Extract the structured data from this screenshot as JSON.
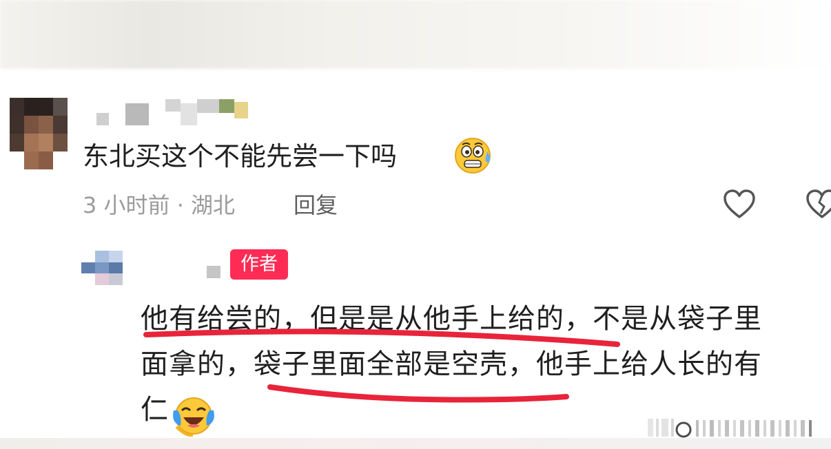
{
  "comment": {
    "text": "东北买这个不能先尝一下吗",
    "emoji_icon": "sweating-face-icon",
    "meta": "3 小时前 · 湖北",
    "reply_label": "回复",
    "like_icon": "heart-icon",
    "dislike_icon": "broken-heart-icon"
  },
  "reply": {
    "author_badge": "作者",
    "lines": [
      "他有给尝的，但是是从他手上给的，不是从袋子里",
      "面拿的，袋子里面全部是空壳，他手上给人长的有",
      "仁"
    ],
    "emoji_icon": "laughing-crying-face-icon"
  },
  "colors": {
    "badge": "#fe2c55",
    "annotation": "#e8243a",
    "meta_text": "#9b9b9b"
  }
}
